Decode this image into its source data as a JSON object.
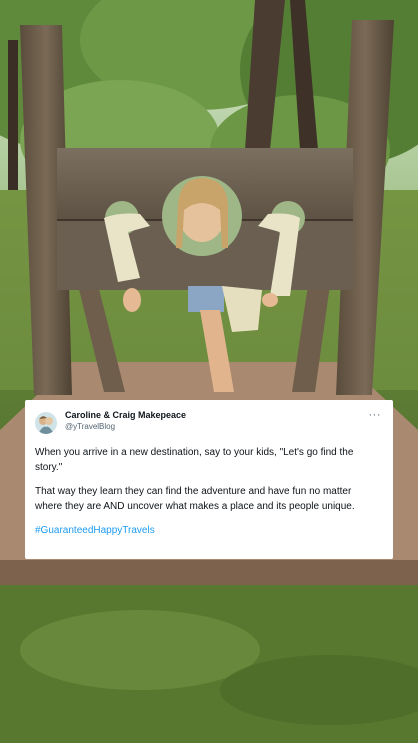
{
  "post": {
    "display_name": "Caroline & Craig Makepeace",
    "handle": "@yTravelBlog",
    "paragraph_1": "When you arrive in a new destination, say to your kids, \"Let's go find the story.\"",
    "paragraph_2": "That way they learn they can find the adventure and have fun no matter where they are AND uncover what makes a place and its people unique.",
    "hashtag": "#GuaranteedHappyTravels",
    "more_icon": "more-horizontal-icon",
    "more_glyph": "···"
  },
  "colors": {
    "card_bg": "#ffffff",
    "text": "#0f1419",
    "muted": "#536471",
    "link": "#1d9bf0"
  }
}
